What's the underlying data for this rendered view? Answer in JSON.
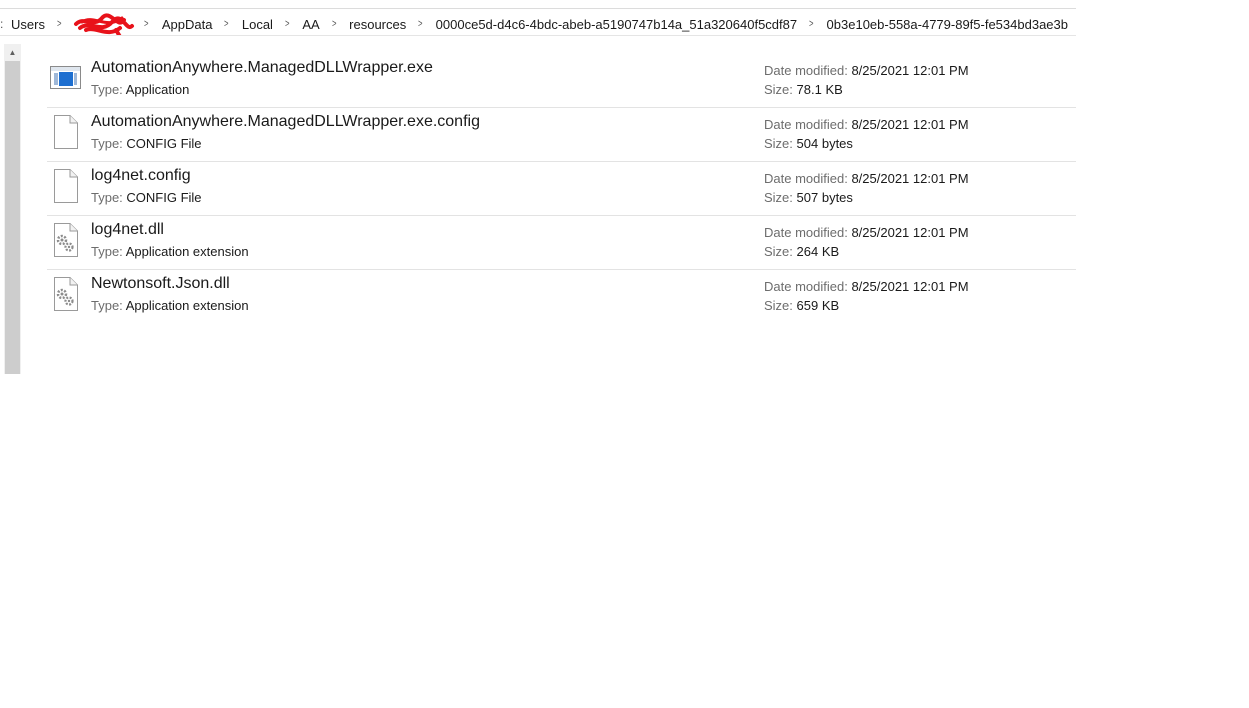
{
  "breadcrumb": {
    "lead": ":",
    "items": [
      {
        "label": "Users"
      },
      {
        "label": "",
        "redacted": true
      },
      {
        "label": "AppData"
      },
      {
        "label": "Local"
      },
      {
        "label": "AA"
      },
      {
        "label": "resources"
      },
      {
        "label": "0000ce5d-d4c6-4bdc-abeb-a5190747b14a_51a320640f5cdf87"
      },
      {
        "label": "0b3e10eb-558a-4779-89f5-fe534bd3ae3b"
      }
    ],
    "separator": ">"
  },
  "labels": {
    "type": "Type:",
    "date_modified": "Date modified:",
    "size": "Size:"
  },
  "files": [
    {
      "name": "AutomationAnywhere.ManagedDLLWrapper.exe",
      "type": "Application",
      "date_modified": "8/25/2021 12:01 PM",
      "size": "78.1 KB",
      "icon": "application-exe-icon"
    },
    {
      "name": "AutomationAnywhere.ManagedDLLWrapper.exe.config",
      "type": "CONFIG File",
      "date_modified": "8/25/2021 12:01 PM",
      "size": "504 bytes",
      "icon": "config-file-icon"
    },
    {
      "name": "log4net.config",
      "type": "CONFIG File",
      "date_modified": "8/25/2021 12:01 PM",
      "size": "507 bytes",
      "icon": "config-file-icon"
    },
    {
      "name": "log4net.dll",
      "type": "Application extension",
      "date_modified": "8/25/2021 12:01 PM",
      "size": "264 KB",
      "icon": "dll-file-icon"
    },
    {
      "name": "Newtonsoft.Json.dll",
      "type": "Application extension",
      "date_modified": "8/25/2021 12:01 PM",
      "size": "659 KB",
      "icon": "dll-file-icon"
    }
  ],
  "colors": {
    "redaction": "#e8121a",
    "exe_icon_blue": "#1e6fd0"
  }
}
